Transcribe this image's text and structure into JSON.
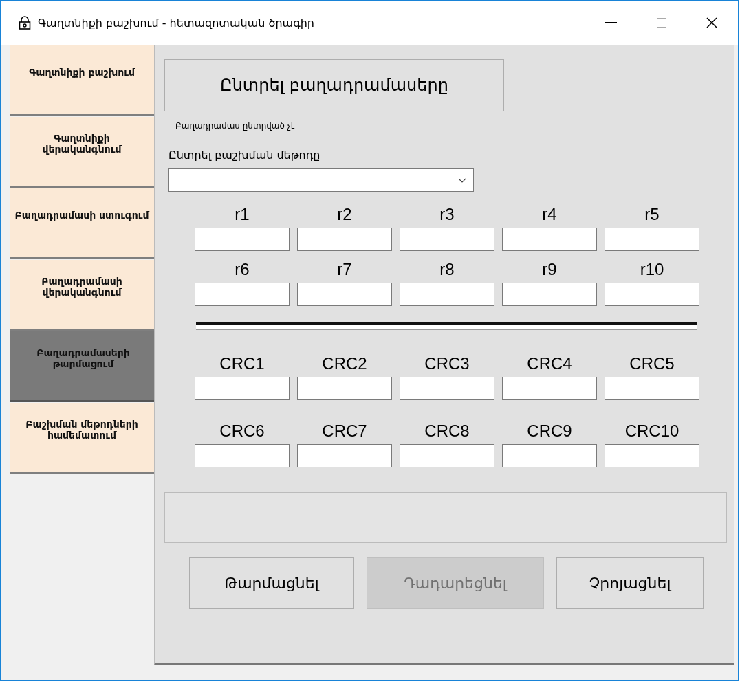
{
  "window": {
    "title": "Գաղտնիքի բաշխում - հետազոտական ծրագիր"
  },
  "sidebar": {
    "items": [
      {
        "label": "Գաղտնիքի բաշխում",
        "selected": false
      },
      {
        "label": "Գաղտնիքի վերականգնում",
        "selected": false
      },
      {
        "label": "Բաղադրամասի ստուգում",
        "selected": false
      },
      {
        "label": "Բաղադրամասի վերականգնում",
        "selected": false
      },
      {
        "label": "Բաղադրամասերի թարմացում",
        "selected": true
      },
      {
        "label": "Բաշխման մեթոդների համեմատում",
        "selected": false
      }
    ]
  },
  "select_button": "Ընտրել բաղադրամասերը",
  "status_text": "Բաղադրամաս ընտրված չէ",
  "method_label": "Ընտրել բաշխման մեթոդը",
  "r_fields": [
    "r1",
    "r2",
    "r3",
    "r4",
    "r5",
    "r6",
    "r7",
    "r8",
    "r9",
    "r10"
  ],
  "crc_fields": [
    "CRC1",
    "CRC2",
    "CRC3",
    "CRC4",
    "CRC5",
    "CRC6",
    "CRC7",
    "CRC8",
    "CRC9",
    "CRC10"
  ],
  "buttons": [
    {
      "label": "Թարմացնել",
      "disabled": false
    },
    {
      "label": "Դադարեցնել",
      "disabled": true
    },
    {
      "label": "Չրոյացնել",
      "disabled": false
    }
  ]
}
